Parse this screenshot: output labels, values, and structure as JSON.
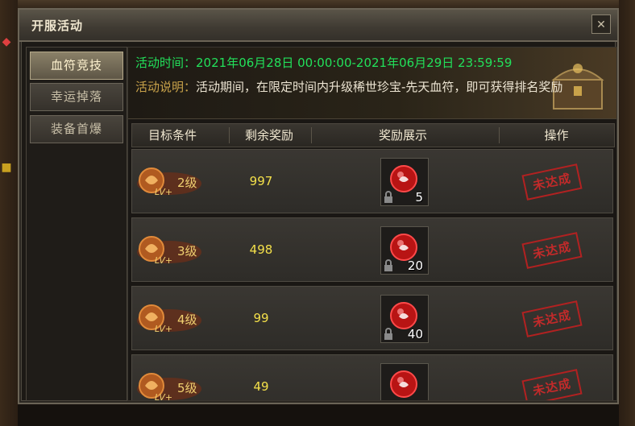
{
  "window": {
    "title": "开服活动",
    "close_icon": "close-icon"
  },
  "tabs": [
    {
      "label": "血符竞技",
      "active": true
    },
    {
      "label": "幸运掉落",
      "active": false
    },
    {
      "label": "装备首爆",
      "active": false
    }
  ],
  "banner": {
    "time_label": "活动时间：",
    "time_value": "2021年06月28日 00:00:00-2021年06月29日 23:59:59",
    "desc_label": "活动说明：",
    "desc_value": "活动期间，在限定时间内升级稀世珍宝-先天血符，即可获得排名奖励"
  },
  "table": {
    "headers": [
      "目标条件",
      "剩余奖励",
      "奖励展示",
      "操作"
    ],
    "rows": [
      {
        "level": "2级",
        "remaining": "997",
        "reward_count": "5",
        "status": "未达成"
      },
      {
        "level": "3级",
        "remaining": "498",
        "reward_count": "20",
        "status": "未达成"
      },
      {
        "level": "4级",
        "remaining": "99",
        "reward_count": "40",
        "status": "未达成"
      },
      {
        "level": "5级",
        "remaining": "49",
        "reward_count": "",
        "status": "未达成"
      }
    ]
  },
  "colors": {
    "accent_green": "#22e05a",
    "label_tan": "#c8a24a",
    "stamp_red": "#c02020",
    "value_yellow": "#f4e04a"
  }
}
